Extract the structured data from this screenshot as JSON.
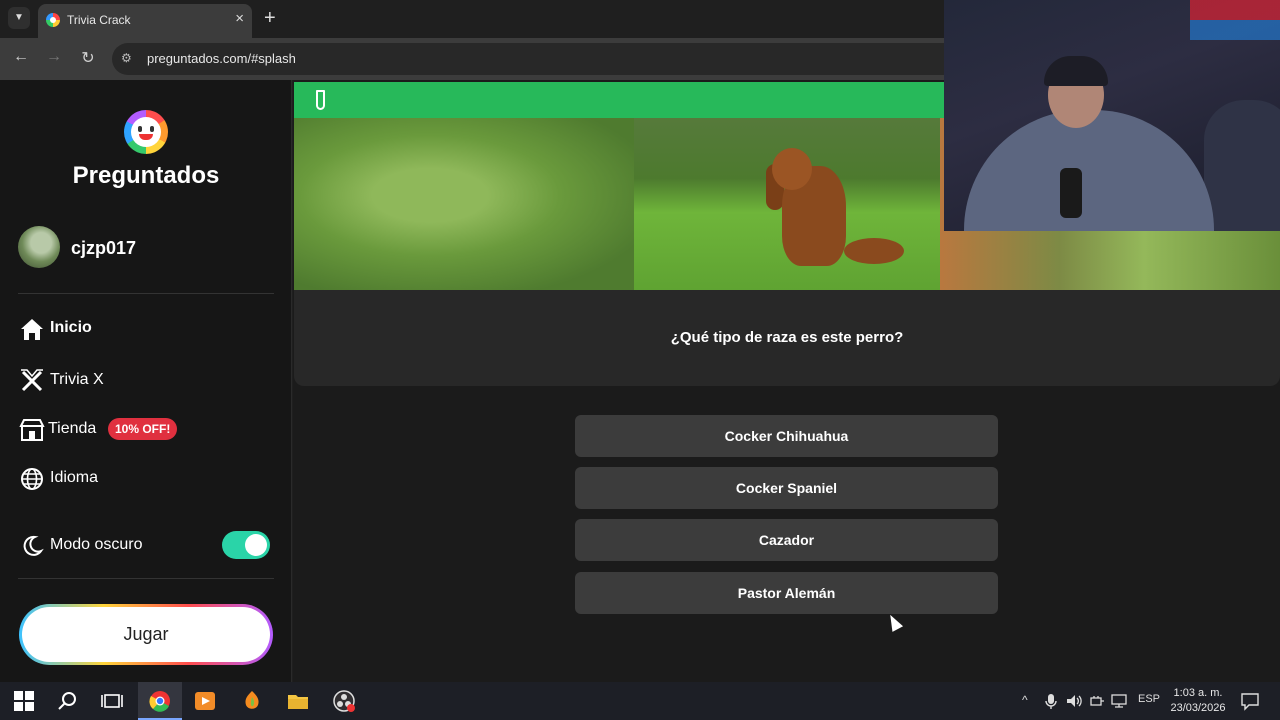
{
  "browser": {
    "tab_title": "Trivia Crack",
    "url": "preguntados.com/#splash"
  },
  "sidebar": {
    "brand": "Preguntados",
    "username": "cjzp017",
    "nav": [
      {
        "label": "Inicio",
        "icon": "home-icon"
      },
      {
        "label": "Trivia X",
        "icon": "trivia-x-icon"
      },
      {
        "label": "Tienda",
        "icon": "store-icon",
        "badge": "10% OFF!"
      },
      {
        "label": "Idioma",
        "icon": "globe-icon"
      }
    ],
    "dark_mode": {
      "label": "Modo oscuro",
      "enabled": true
    },
    "play_label": "Jugar"
  },
  "game": {
    "category_color": "#27b95a",
    "question": "¿Qué tipo de raza es este perro?",
    "answers": [
      "Cocker Chihuahua",
      "Cocker Spaniel",
      "Cazador",
      "Pastor Alemán"
    ]
  },
  "taskbar": {
    "lang": "ESP",
    "time": "1:03 a. m.",
    "date": "23/03/2026"
  },
  "colors": {
    "accent_toggle": "#2ad4a8",
    "promo_badge": "#e0303f"
  }
}
